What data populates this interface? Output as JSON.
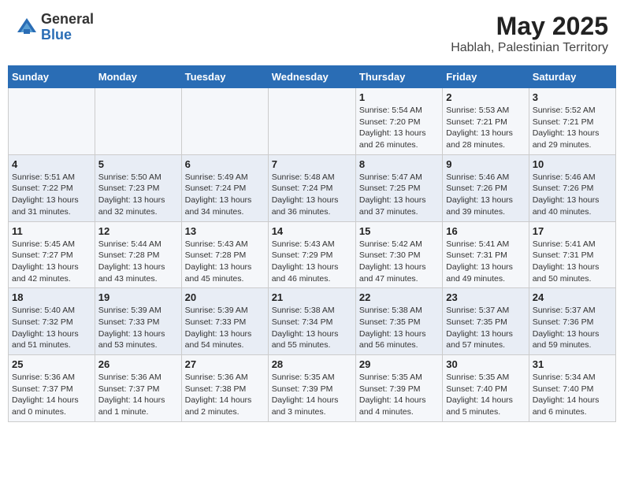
{
  "header": {
    "logo_general": "General",
    "logo_blue": "Blue",
    "month_title": "May 2025",
    "location": "Hablah, Palestinian Territory"
  },
  "days_of_week": [
    "Sunday",
    "Monday",
    "Tuesday",
    "Wednesday",
    "Thursday",
    "Friday",
    "Saturday"
  ],
  "weeks": [
    [
      {
        "day": "",
        "info": ""
      },
      {
        "day": "",
        "info": ""
      },
      {
        "day": "",
        "info": ""
      },
      {
        "day": "",
        "info": ""
      },
      {
        "day": "1",
        "info": "Sunrise: 5:54 AM\nSunset: 7:20 PM\nDaylight: 13 hours\nand 26 minutes."
      },
      {
        "day": "2",
        "info": "Sunrise: 5:53 AM\nSunset: 7:21 PM\nDaylight: 13 hours\nand 28 minutes."
      },
      {
        "day": "3",
        "info": "Sunrise: 5:52 AM\nSunset: 7:21 PM\nDaylight: 13 hours\nand 29 minutes."
      }
    ],
    [
      {
        "day": "4",
        "info": "Sunrise: 5:51 AM\nSunset: 7:22 PM\nDaylight: 13 hours\nand 31 minutes."
      },
      {
        "day": "5",
        "info": "Sunrise: 5:50 AM\nSunset: 7:23 PM\nDaylight: 13 hours\nand 32 minutes."
      },
      {
        "day": "6",
        "info": "Sunrise: 5:49 AM\nSunset: 7:24 PM\nDaylight: 13 hours\nand 34 minutes."
      },
      {
        "day": "7",
        "info": "Sunrise: 5:48 AM\nSunset: 7:24 PM\nDaylight: 13 hours\nand 36 minutes."
      },
      {
        "day": "8",
        "info": "Sunrise: 5:47 AM\nSunset: 7:25 PM\nDaylight: 13 hours\nand 37 minutes."
      },
      {
        "day": "9",
        "info": "Sunrise: 5:46 AM\nSunset: 7:26 PM\nDaylight: 13 hours\nand 39 minutes."
      },
      {
        "day": "10",
        "info": "Sunrise: 5:46 AM\nSunset: 7:26 PM\nDaylight: 13 hours\nand 40 minutes."
      }
    ],
    [
      {
        "day": "11",
        "info": "Sunrise: 5:45 AM\nSunset: 7:27 PM\nDaylight: 13 hours\nand 42 minutes."
      },
      {
        "day": "12",
        "info": "Sunrise: 5:44 AM\nSunset: 7:28 PM\nDaylight: 13 hours\nand 43 minutes."
      },
      {
        "day": "13",
        "info": "Sunrise: 5:43 AM\nSunset: 7:28 PM\nDaylight: 13 hours\nand 45 minutes."
      },
      {
        "day": "14",
        "info": "Sunrise: 5:43 AM\nSunset: 7:29 PM\nDaylight: 13 hours\nand 46 minutes."
      },
      {
        "day": "15",
        "info": "Sunrise: 5:42 AM\nSunset: 7:30 PM\nDaylight: 13 hours\nand 47 minutes."
      },
      {
        "day": "16",
        "info": "Sunrise: 5:41 AM\nSunset: 7:31 PM\nDaylight: 13 hours\nand 49 minutes."
      },
      {
        "day": "17",
        "info": "Sunrise: 5:41 AM\nSunset: 7:31 PM\nDaylight: 13 hours\nand 50 minutes."
      }
    ],
    [
      {
        "day": "18",
        "info": "Sunrise: 5:40 AM\nSunset: 7:32 PM\nDaylight: 13 hours\nand 51 minutes."
      },
      {
        "day": "19",
        "info": "Sunrise: 5:39 AM\nSunset: 7:33 PM\nDaylight: 13 hours\nand 53 minutes."
      },
      {
        "day": "20",
        "info": "Sunrise: 5:39 AM\nSunset: 7:33 PM\nDaylight: 13 hours\nand 54 minutes."
      },
      {
        "day": "21",
        "info": "Sunrise: 5:38 AM\nSunset: 7:34 PM\nDaylight: 13 hours\nand 55 minutes."
      },
      {
        "day": "22",
        "info": "Sunrise: 5:38 AM\nSunset: 7:35 PM\nDaylight: 13 hours\nand 56 minutes."
      },
      {
        "day": "23",
        "info": "Sunrise: 5:37 AM\nSunset: 7:35 PM\nDaylight: 13 hours\nand 57 minutes."
      },
      {
        "day": "24",
        "info": "Sunrise: 5:37 AM\nSunset: 7:36 PM\nDaylight: 13 hours\nand 59 minutes."
      }
    ],
    [
      {
        "day": "25",
        "info": "Sunrise: 5:36 AM\nSunset: 7:37 PM\nDaylight: 14 hours\nand 0 minutes."
      },
      {
        "day": "26",
        "info": "Sunrise: 5:36 AM\nSunset: 7:37 PM\nDaylight: 14 hours\nand 1 minute."
      },
      {
        "day": "27",
        "info": "Sunrise: 5:36 AM\nSunset: 7:38 PM\nDaylight: 14 hours\nand 2 minutes."
      },
      {
        "day": "28",
        "info": "Sunrise: 5:35 AM\nSunset: 7:39 PM\nDaylight: 14 hours\nand 3 minutes."
      },
      {
        "day": "29",
        "info": "Sunrise: 5:35 AM\nSunset: 7:39 PM\nDaylight: 14 hours\nand 4 minutes."
      },
      {
        "day": "30",
        "info": "Sunrise: 5:35 AM\nSunset: 7:40 PM\nDaylight: 14 hours\nand 5 minutes."
      },
      {
        "day": "31",
        "info": "Sunrise: 5:34 AM\nSunset: 7:40 PM\nDaylight: 14 hours\nand 6 minutes."
      }
    ]
  ]
}
